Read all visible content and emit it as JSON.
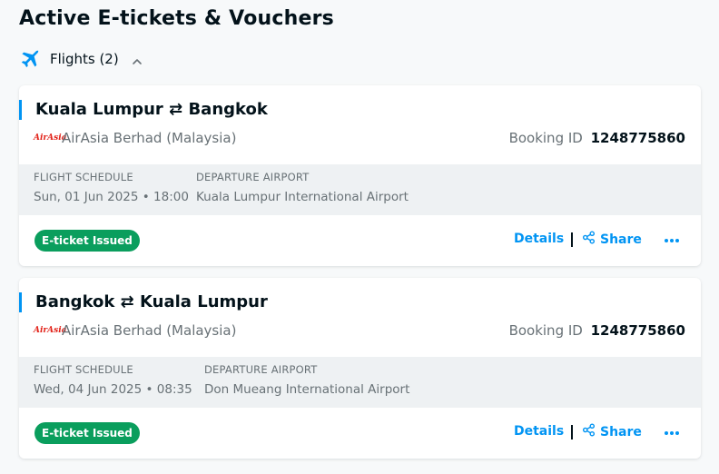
{
  "page_title": "Active E-tickets & Vouchers",
  "section": {
    "label": "Flights (2)",
    "icon": "airplane-icon",
    "toggle_icon": "chevron-up-icon"
  },
  "colors": {
    "accent": "#0194f3",
    "badge": "#0a9e5d",
    "brand": "#e2231a"
  },
  "bookings": [
    {
      "route_from": "Kuala Lumpur",
      "route_to": "Bangkok",
      "route_icon": "swap-arrows-icon",
      "airline_logo": "AirAsia",
      "airline": "AirAsia Berhad (Malaysia)",
      "booking_label": "Booking ID",
      "booking_id": "1248775860",
      "schedule_header": "FLIGHT SCHEDULE",
      "schedule_value": "Sun, 01 Jun 2025 • 18:00",
      "airport_header": "DEPARTURE AIRPORT",
      "airport_value": "Kuala Lumpur International Airport",
      "status": "E-ticket Issued",
      "details_label": "Details",
      "share_label": "Share"
    },
    {
      "route_from": "Bangkok",
      "route_to": "Kuala Lumpur",
      "route_icon": "swap-arrows-icon",
      "airline_logo": "AirAsia",
      "airline": "AirAsia Berhad (Malaysia)",
      "booking_label": "Booking ID",
      "booking_id": "1248775860",
      "schedule_header": "FLIGHT SCHEDULE",
      "schedule_value": "Wed, 04 Jun 2025 • 08:35",
      "airport_header": "DEPARTURE AIRPORT",
      "airport_value": "Don Mueang International Airport",
      "status": "E-ticket Issued",
      "details_label": "Details",
      "share_label": "Share"
    }
  ]
}
